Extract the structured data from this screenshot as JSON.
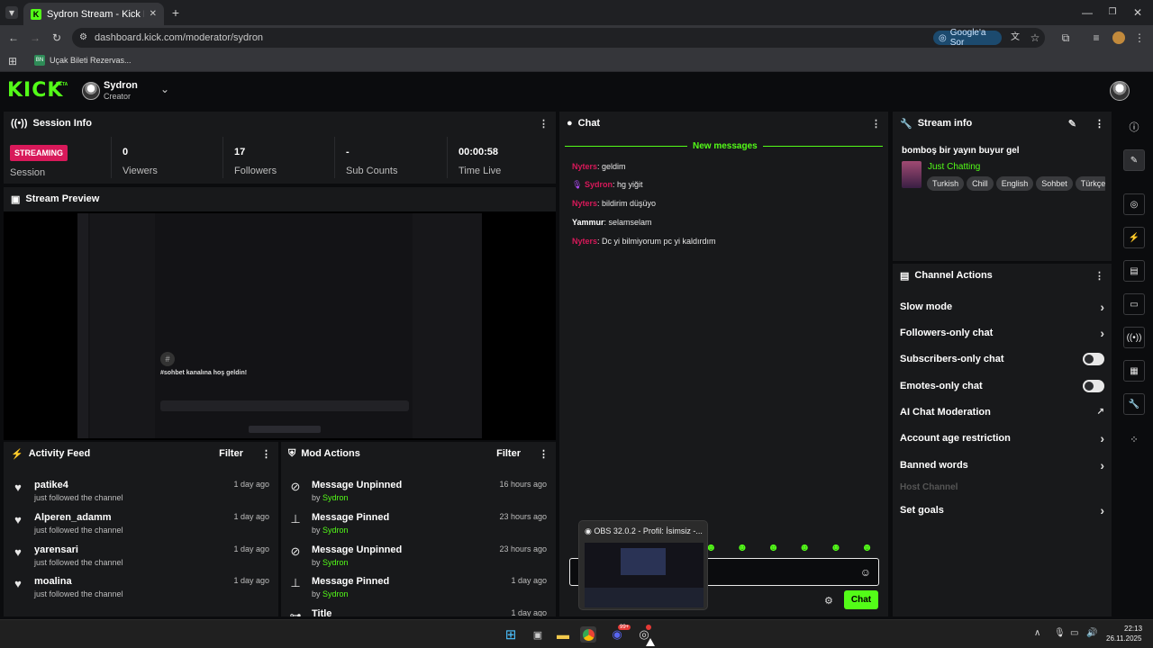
{
  "browser": {
    "tab_title": "Sydron Stream - Kick Dashboard",
    "url": "dashboard.kick.com/moderator/sydron",
    "google_chip": "Google'a Sor",
    "bookmark": "Uçak Bileti Rezervas..."
  },
  "header": {
    "logo": "KICK",
    "beta": "BETA",
    "user_name": "Sydron",
    "user_role": "Creator"
  },
  "session": {
    "title": "Session Info",
    "live_badge": "STREAMING",
    "session_label": "Session",
    "stats": [
      {
        "value": "0",
        "label": "Viewers"
      },
      {
        "value": "17",
        "label": "Followers"
      },
      {
        "value": "-",
        "label": "Sub Counts"
      },
      {
        "value": "00:00:58",
        "label": "Time Live"
      }
    ]
  },
  "preview": {
    "title": "Stream Preview",
    "preview_text": "#sohbet kanalına hoş geldin!"
  },
  "activity": {
    "title": "Activity Feed",
    "filter": "Filter",
    "items": [
      {
        "name": "patike4",
        "sub": "just followed the channel",
        "time": "1 day ago"
      },
      {
        "name": "Alperen_adamm",
        "sub": "just followed the channel",
        "time": "1 day ago"
      },
      {
        "name": "yarensari",
        "sub": "just followed the channel",
        "time": "1 day ago"
      },
      {
        "name": "moalina",
        "sub": "just followed the channel",
        "time": "1 day ago"
      }
    ]
  },
  "mod_actions": {
    "title": "Mod Actions",
    "filter": "Filter",
    "by": "by",
    "items": [
      {
        "action": "Message Unpinned",
        "user": "Sydron",
        "time": "16 hours ago"
      },
      {
        "action": "Message Pinned",
        "user": "Sydron",
        "time": "23 hours ago"
      },
      {
        "action": "Message Unpinned",
        "user": "Sydron",
        "time": "23 hours ago"
      },
      {
        "action": "Message Pinned",
        "user": "Sydron",
        "time": "1 day ago"
      },
      {
        "action": "Title",
        "user": "",
        "time": "1 day ago"
      }
    ]
  },
  "chat": {
    "title": "Chat",
    "new_messages": "New messages",
    "messages": [
      {
        "user": "Nyters",
        "text": ": geldim"
      },
      {
        "user": "Sydron",
        "text": ": hg yiğit"
      },
      {
        "user": "Nyters",
        "text": ": bildirim düşüyo"
      },
      {
        "user": "Yammur",
        "text": ": selamselam"
      },
      {
        "user": "Nyters",
        "text": ": Dc yi bilmiyorum pc yi kaldırdım"
      }
    ],
    "send_label": "Chat"
  },
  "stream_info": {
    "title": "Stream info",
    "stream_title": "bomboş bir yayın buyur gel",
    "category": "Just Chatting",
    "tags": [
      "Turkish",
      "Chill",
      "English",
      "Sohbet",
      "Türkçe"
    ]
  },
  "channel_actions": {
    "title": "Channel Actions",
    "items": [
      "Slow mode",
      "Followers-only chat",
      "Subscribers-only chat",
      "Emotes-only chat",
      "AI Chat Moderation",
      "Account age restriction",
      "Banned words",
      "Host Channel",
      "Set goals"
    ]
  },
  "obs_popup": {
    "title": "OBS 32.0.2 - Profil: İsimsiz -..."
  },
  "taskbar": {
    "time": "22:13",
    "date": "26.11.2025",
    "discord_badge": "99+"
  },
  "colors": {
    "kick_green": "#53fc18",
    "live_red": "#d8195a",
    "panel_bg": "#18191b"
  }
}
